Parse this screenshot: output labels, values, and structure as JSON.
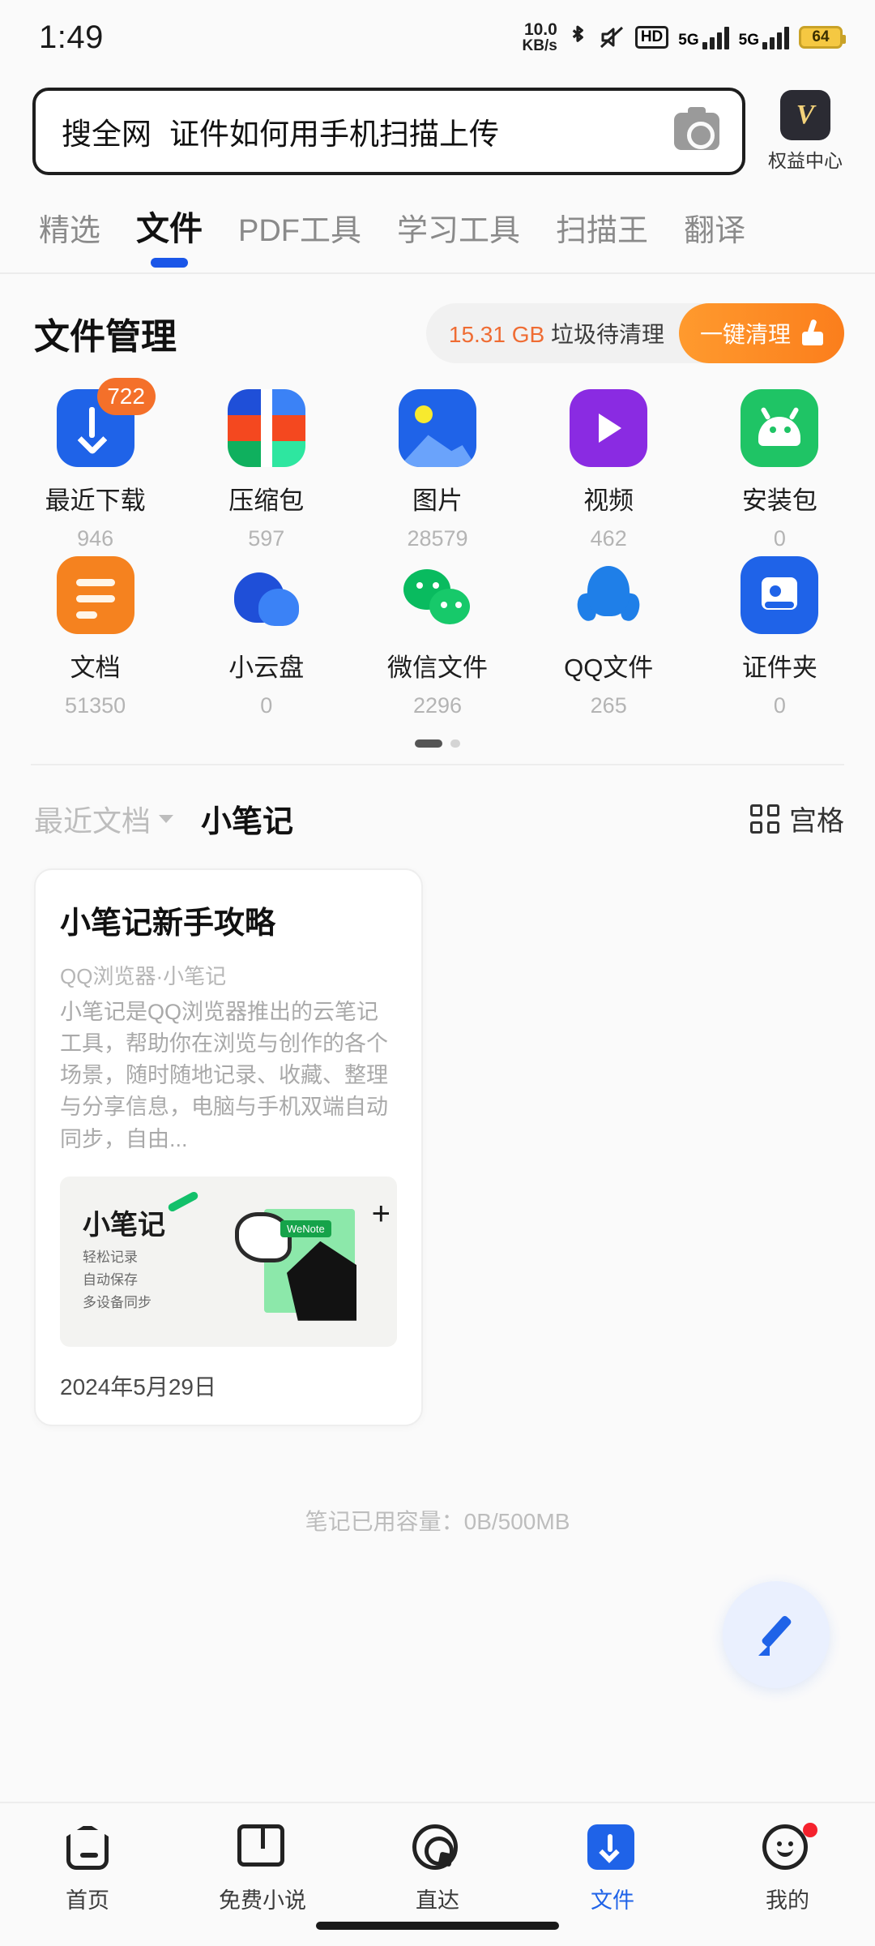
{
  "statusbar": {
    "time": "1:49",
    "netspeed_value": "10.0",
    "netspeed_unit": "KB/s",
    "bluetooth_icon": "bluetooth-icon",
    "mute_icon": "mute-icon",
    "hd_label": "HD",
    "network_label_1": "5G",
    "network_label_2": "5G",
    "battery_level": "64"
  },
  "search": {
    "scope": "搜全网",
    "keyword": "证件如何用手机扫描上传",
    "camera_icon": "camera-icon",
    "vip_glyph": "V",
    "vip_label": "权益中心"
  },
  "tabs": [
    {
      "label": "精选",
      "active": false
    },
    {
      "label": "文件",
      "active": true
    },
    {
      "label": "PDF工具",
      "active": false
    },
    {
      "label": "学习工具",
      "active": false
    },
    {
      "label": "扫描王",
      "active": false
    },
    {
      "label": "翻译",
      "active": false
    }
  ],
  "file_manager": {
    "title": "文件管理",
    "junk_size": "15.31 GB",
    "junk_text": "垃圾待清理",
    "clean_button": "一键清理",
    "accent_orange": "#ef6c33",
    "accent_blue": "#1f63e8",
    "items": [
      {
        "name": "最近下载",
        "count": "946",
        "badge": "722",
        "icon": "download-icon"
      },
      {
        "name": "压缩包",
        "count": "597",
        "badge": "",
        "icon": "archive-icon"
      },
      {
        "name": "图片",
        "count": "28579",
        "badge": "",
        "icon": "image-icon"
      },
      {
        "name": "视频",
        "count": "462",
        "badge": "",
        "icon": "video-icon"
      },
      {
        "name": "安装包",
        "count": "0",
        "badge": "",
        "icon": "apk-icon"
      },
      {
        "name": "文档",
        "count": "51350",
        "badge": "",
        "icon": "document-icon"
      },
      {
        "name": "小云盘",
        "count": "0",
        "badge": "",
        "icon": "cloud-icon"
      },
      {
        "name": "微信文件",
        "count": "2296",
        "badge": "",
        "icon": "wechat-icon"
      },
      {
        "name": "QQ文件",
        "count": "265",
        "badge": "",
        "icon": "qq-icon"
      },
      {
        "name": "证件夹",
        "count": "0",
        "badge": "",
        "icon": "id-card-icon"
      }
    ]
  },
  "recent": {
    "tab_recent": "最近文档",
    "tab_notes": "小笔记",
    "view_mode": "宫格",
    "grid_icon": "grid-view-icon",
    "note": {
      "title": "小笔记新手攻略",
      "source": "QQ浏览器·小笔记",
      "body": "小笔记是QQ浏览器推出的云笔记工具，帮助你在浏览与创作的各个场景，随时随地记录、收藏、整理与分享信息，电脑与手机双端自动同步，自由...",
      "thumb_title": "小笔记",
      "thumb_lines": "轻松记录\n自动保存\n多设备同步",
      "thumb_chip": "WeNote",
      "date": "2024年5月29日"
    },
    "quota": "笔记已用容量：0B/500MB"
  },
  "fab": {
    "icon": "edit-pen-icon"
  },
  "bottomnav": [
    {
      "label": "首页",
      "icon": "home-icon",
      "active": false,
      "dot": false
    },
    {
      "label": "免费小说",
      "icon": "book-icon",
      "active": false,
      "dot": false
    },
    {
      "label": "直达",
      "icon": "direct-icon",
      "active": false,
      "dot": false
    },
    {
      "label": "文件",
      "icon": "file-icon",
      "active": true,
      "dot": false
    },
    {
      "label": "我的",
      "icon": "profile-icon",
      "active": false,
      "dot": true
    }
  ]
}
